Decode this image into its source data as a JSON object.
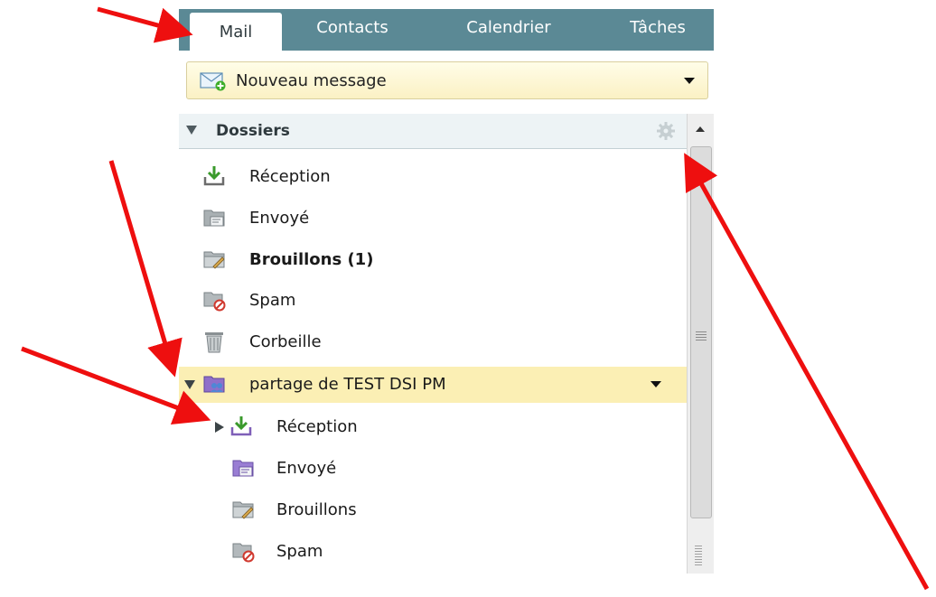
{
  "tabs": [
    {
      "label": "Mail",
      "active": true
    },
    {
      "label": "Contacts",
      "active": false
    },
    {
      "label": "Calendrier",
      "active": false
    },
    {
      "label": "Tâches",
      "active": false
    }
  ],
  "new_message": {
    "label": "Nouveau message",
    "icon": "new-mail-icon"
  },
  "folders_header": {
    "label": "Dossiers",
    "settings_icon": "gear-icon"
  },
  "folders": [
    {
      "label": "Réception",
      "icon": "inbox-download-icon"
    },
    {
      "label": "Envoyé",
      "icon": "sent-folder-icon"
    },
    {
      "label": "Brouillons (1)",
      "icon": "drafts-folder-icon",
      "bold": true
    },
    {
      "label": "Spam",
      "icon": "spam-folder-icon"
    },
    {
      "label": "Corbeille",
      "icon": "trash-icon"
    }
  ],
  "shared_mailbox": {
    "label": "partage de TEST DSI PM",
    "icon": "shared-mailbox-icon",
    "highlight_color": "#fbefb4"
  },
  "shared_folders": [
    {
      "label": "Réception",
      "icon": "inbox-download-icon",
      "collapsed": true
    },
    {
      "label": "Envoyé",
      "icon": "sent-folder-icon"
    },
    {
      "label": "Brouillons",
      "icon": "drafts-folder-icon"
    },
    {
      "label": "Spam",
      "icon": "spam-folder-icon"
    }
  ],
  "colors": {
    "tab_bar": "#5b8995",
    "annotation_arrow": "#ee0f0f",
    "new_message_bg": "#fbf1c4"
  }
}
